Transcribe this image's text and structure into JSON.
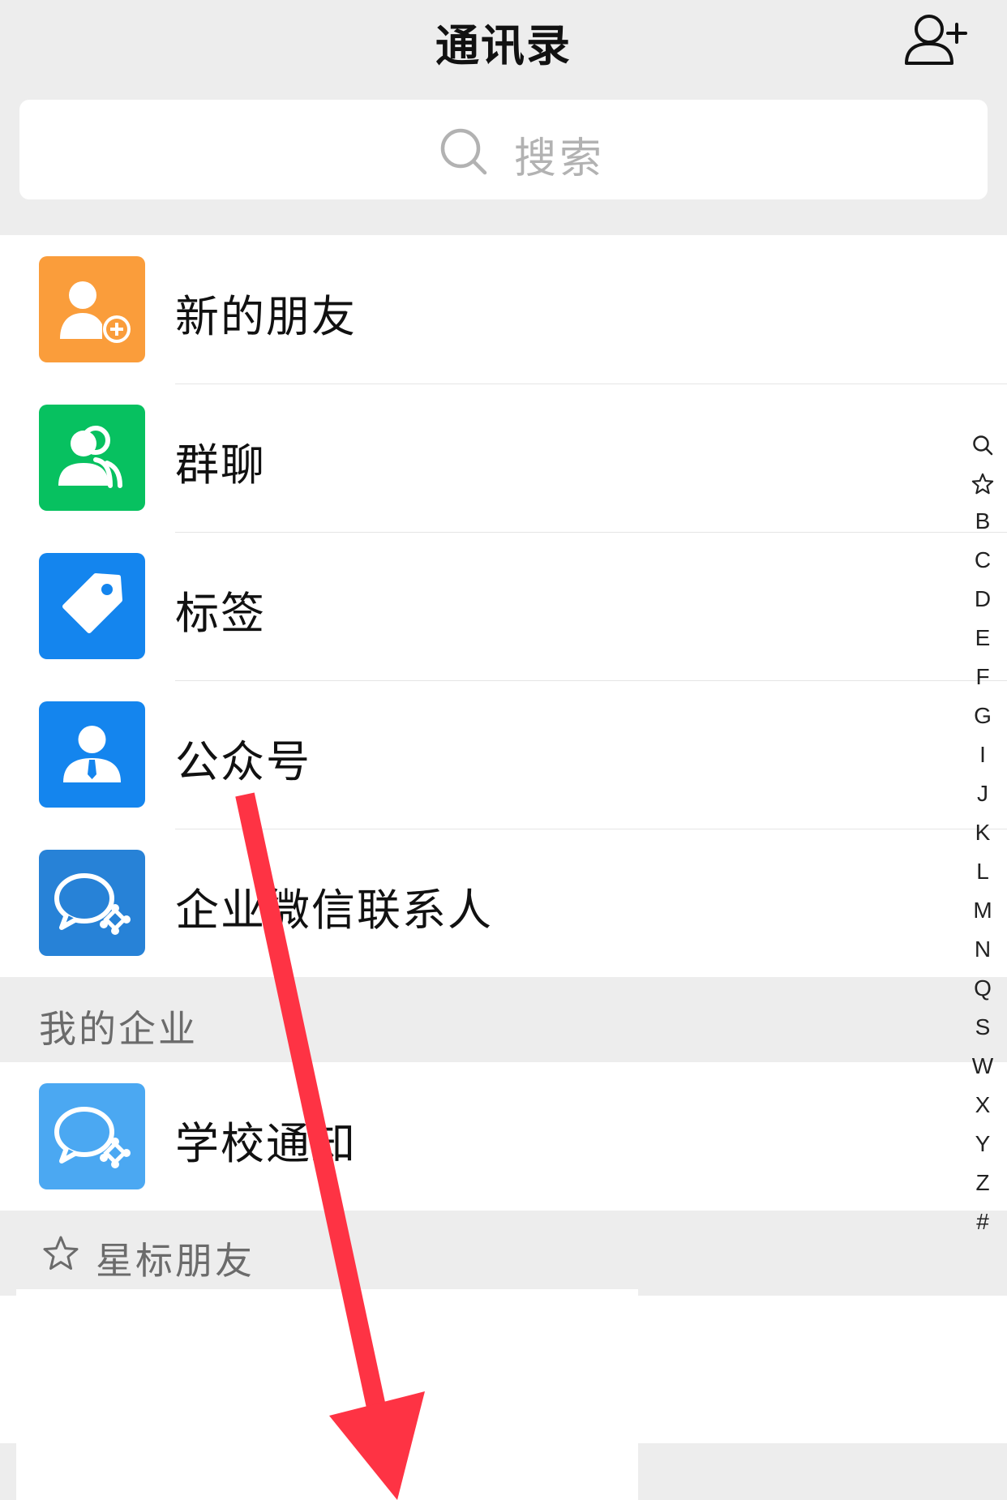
{
  "header": {
    "title": "通讯录",
    "add_icon": "add-contact-icon"
  },
  "search": {
    "placeholder": "搜索",
    "icon": "search-icon"
  },
  "entries": [
    {
      "label": "新的朋友",
      "icon": "new-friends-icon",
      "color": "#fa9d3b"
    },
    {
      "label": "群聊",
      "icon": "group-chat-icon",
      "color": "#07c160"
    },
    {
      "label": "标签",
      "icon": "tag-icon",
      "color": "#1485ee"
    },
    {
      "label": "公众号",
      "icon": "official-account-icon",
      "color": "#1485ee"
    },
    {
      "label": "企业微信联系人",
      "icon": "wecom-contacts-icon",
      "color": "#2782d7"
    }
  ],
  "sections": {
    "my_enterprise": {
      "label": "我的企业",
      "items": [
        {
          "label": "学校通知",
          "icon": "wecom-icon",
          "color": "#4ba8f2"
        }
      ]
    },
    "starred": {
      "label": "星标朋友",
      "icon": "star-icon"
    }
  },
  "index_bar": {
    "items": [
      "search",
      "star",
      "B",
      "C",
      "D",
      "E",
      "F",
      "G",
      "I",
      "J",
      "K",
      "L",
      "M",
      "N",
      "Q",
      "S",
      "W",
      "X",
      "Y",
      "Z",
      "#"
    ]
  },
  "annotation": {
    "icon": "down-arrow-icon",
    "color": "#fe3344"
  }
}
